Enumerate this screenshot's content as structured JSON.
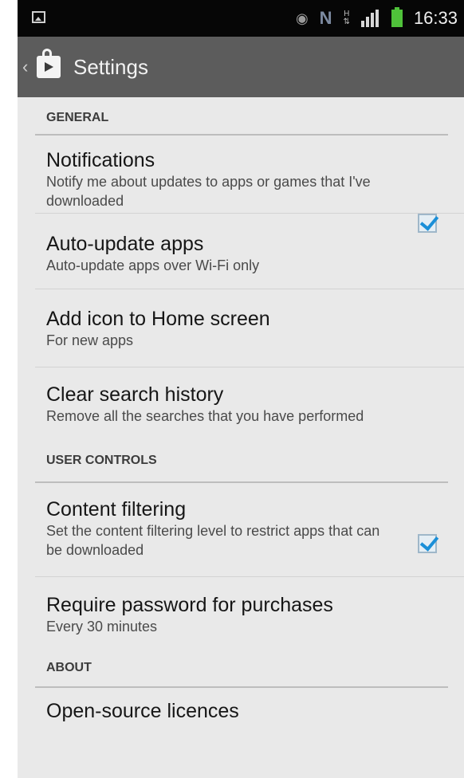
{
  "status_bar": {
    "time": "16:33",
    "icons": [
      "picture-icon",
      "eye-icon",
      "nfc-n-icon",
      "hsdpa-icon",
      "signal-icon",
      "battery-icon"
    ],
    "hsdpa_label": "H"
  },
  "action_bar": {
    "title": "Settings",
    "back_glyph": "‹"
  },
  "sections": {
    "general": {
      "header": "GENERAL",
      "notifications": {
        "title": "Notifications",
        "summary": "Notify me about updates to apps or games that I've downloaded",
        "checked": true
      },
      "auto_update": {
        "title": "Auto-update apps",
        "summary": "Auto-update apps over Wi-Fi only"
      },
      "add_icon": {
        "title": "Add icon to Home screen",
        "summary": "For new apps",
        "checked": true
      },
      "clear_history": {
        "title": "Clear search history",
        "summary": "Remove all the searches that you have performed"
      }
    },
    "user_controls": {
      "header": "USER CONTROLS",
      "content_filtering": {
        "title": "Content filtering",
        "summary": "Set the content filtering level to restrict apps that can be downloaded"
      },
      "require_password": {
        "title": "Require password for purchases",
        "summary": "Every 30 minutes"
      }
    },
    "about": {
      "header": "ABOUT",
      "licences": {
        "title": "Open-source licences"
      }
    }
  },
  "colors": {
    "status_bar": "#060606",
    "action_bar": "#5c5c5c",
    "background": "#e9e9e9",
    "checkbox_check": "#1a8fd8",
    "battery": "#4fc23a"
  }
}
